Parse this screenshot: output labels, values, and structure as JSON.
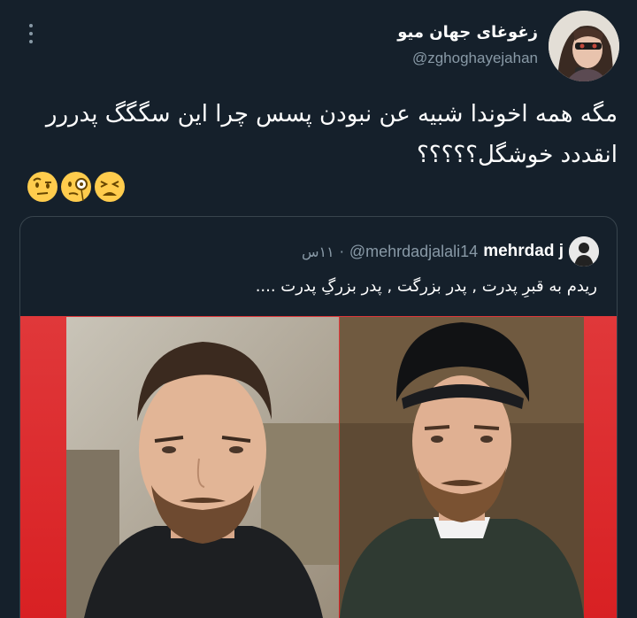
{
  "tweet": {
    "author_name": "زغوغای جهان میو",
    "author_handle": "@zghoghayejahan",
    "text": "مگه همه اخوندا شبیه عن نبودن پسس چرا این سگگگ پدررر انقددد خوشگل؟؟؟؟؟",
    "emojis": [
      "raised-eyebrow-emoji",
      "face-with-monocle-emoji",
      "tired-face-emoji"
    ]
  },
  "quoted_tweet": {
    "author_name": "mehrdad j",
    "author_handle": "@mehrdadjalali14",
    "separator": "·",
    "time": "۱۱س",
    "text": "ریدم به قبرِ پدرت , پدر بزرگت , پدر بزرگِ پدرت ....",
    "media": [
      "photo-young-man-beard",
      "photo-cleric-turban"
    ]
  },
  "colors": {
    "background": "#15202b",
    "secondary_text": "#8899a6",
    "border": "#38444d",
    "media_frame": "#d81f22"
  }
}
